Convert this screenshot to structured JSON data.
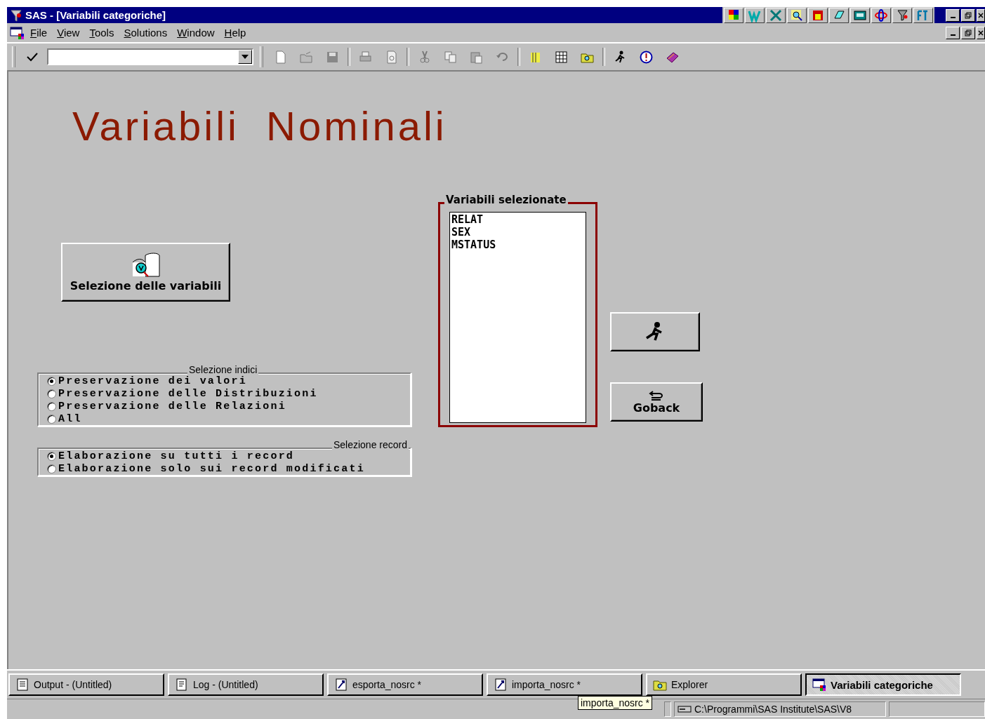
{
  "window": {
    "title": "SAS - [Variabili categoriche]"
  },
  "menu": [
    {
      "label": "File"
    },
    {
      "label": "View"
    },
    {
      "label": "Tools"
    },
    {
      "label": "Solutions"
    },
    {
      "label": "Window"
    },
    {
      "label": "Help"
    }
  ],
  "frame": {
    "heading": "Variabili Nominali",
    "select_button": {
      "label": "Selezione delle variabili"
    },
    "indices_group": {
      "label": "Selezione indici",
      "options": [
        {
          "label": "Preservazione dei valori",
          "selected": true
        },
        {
          "label": "Preservazione delle Distribuzioni",
          "selected": false
        },
        {
          "label": "Preservazione delle Relazioni",
          "selected": false
        },
        {
          "label": "All",
          "selected": false
        }
      ]
    },
    "record_group": {
      "label": "Selezione record",
      "options": [
        {
          "label": "Elaborazione su tutti i record",
          "selected": true
        },
        {
          "label": "Elaborazione solo sui record modificati",
          "selected": false
        }
      ]
    },
    "selected_list": {
      "label": "Variabili selezionate",
      "items": [
        "RELAT",
        "SEX",
        "MSTATUS"
      ]
    },
    "goback_button": {
      "label": "Goback"
    }
  },
  "taskbar": [
    {
      "label": "Output - (Untitled)",
      "kind": "output",
      "selected": false
    },
    {
      "label": "Log - (Untitled)",
      "kind": "log",
      "selected": false
    },
    {
      "label": "esporta_nosrc *",
      "kind": "program",
      "selected": false
    },
    {
      "label": "importa_nosrc *",
      "kind": "program",
      "selected": false
    },
    {
      "label": "Explorer",
      "kind": "explorer",
      "selected": false
    },
    {
      "label": "Variabili categoriche",
      "kind": "frame",
      "selected": true
    }
  ],
  "tooltip": "importa_nosrc *",
  "status_bar": {
    "path": "C:\\Programmi\\SAS Institute\\SAS\\V8"
  }
}
